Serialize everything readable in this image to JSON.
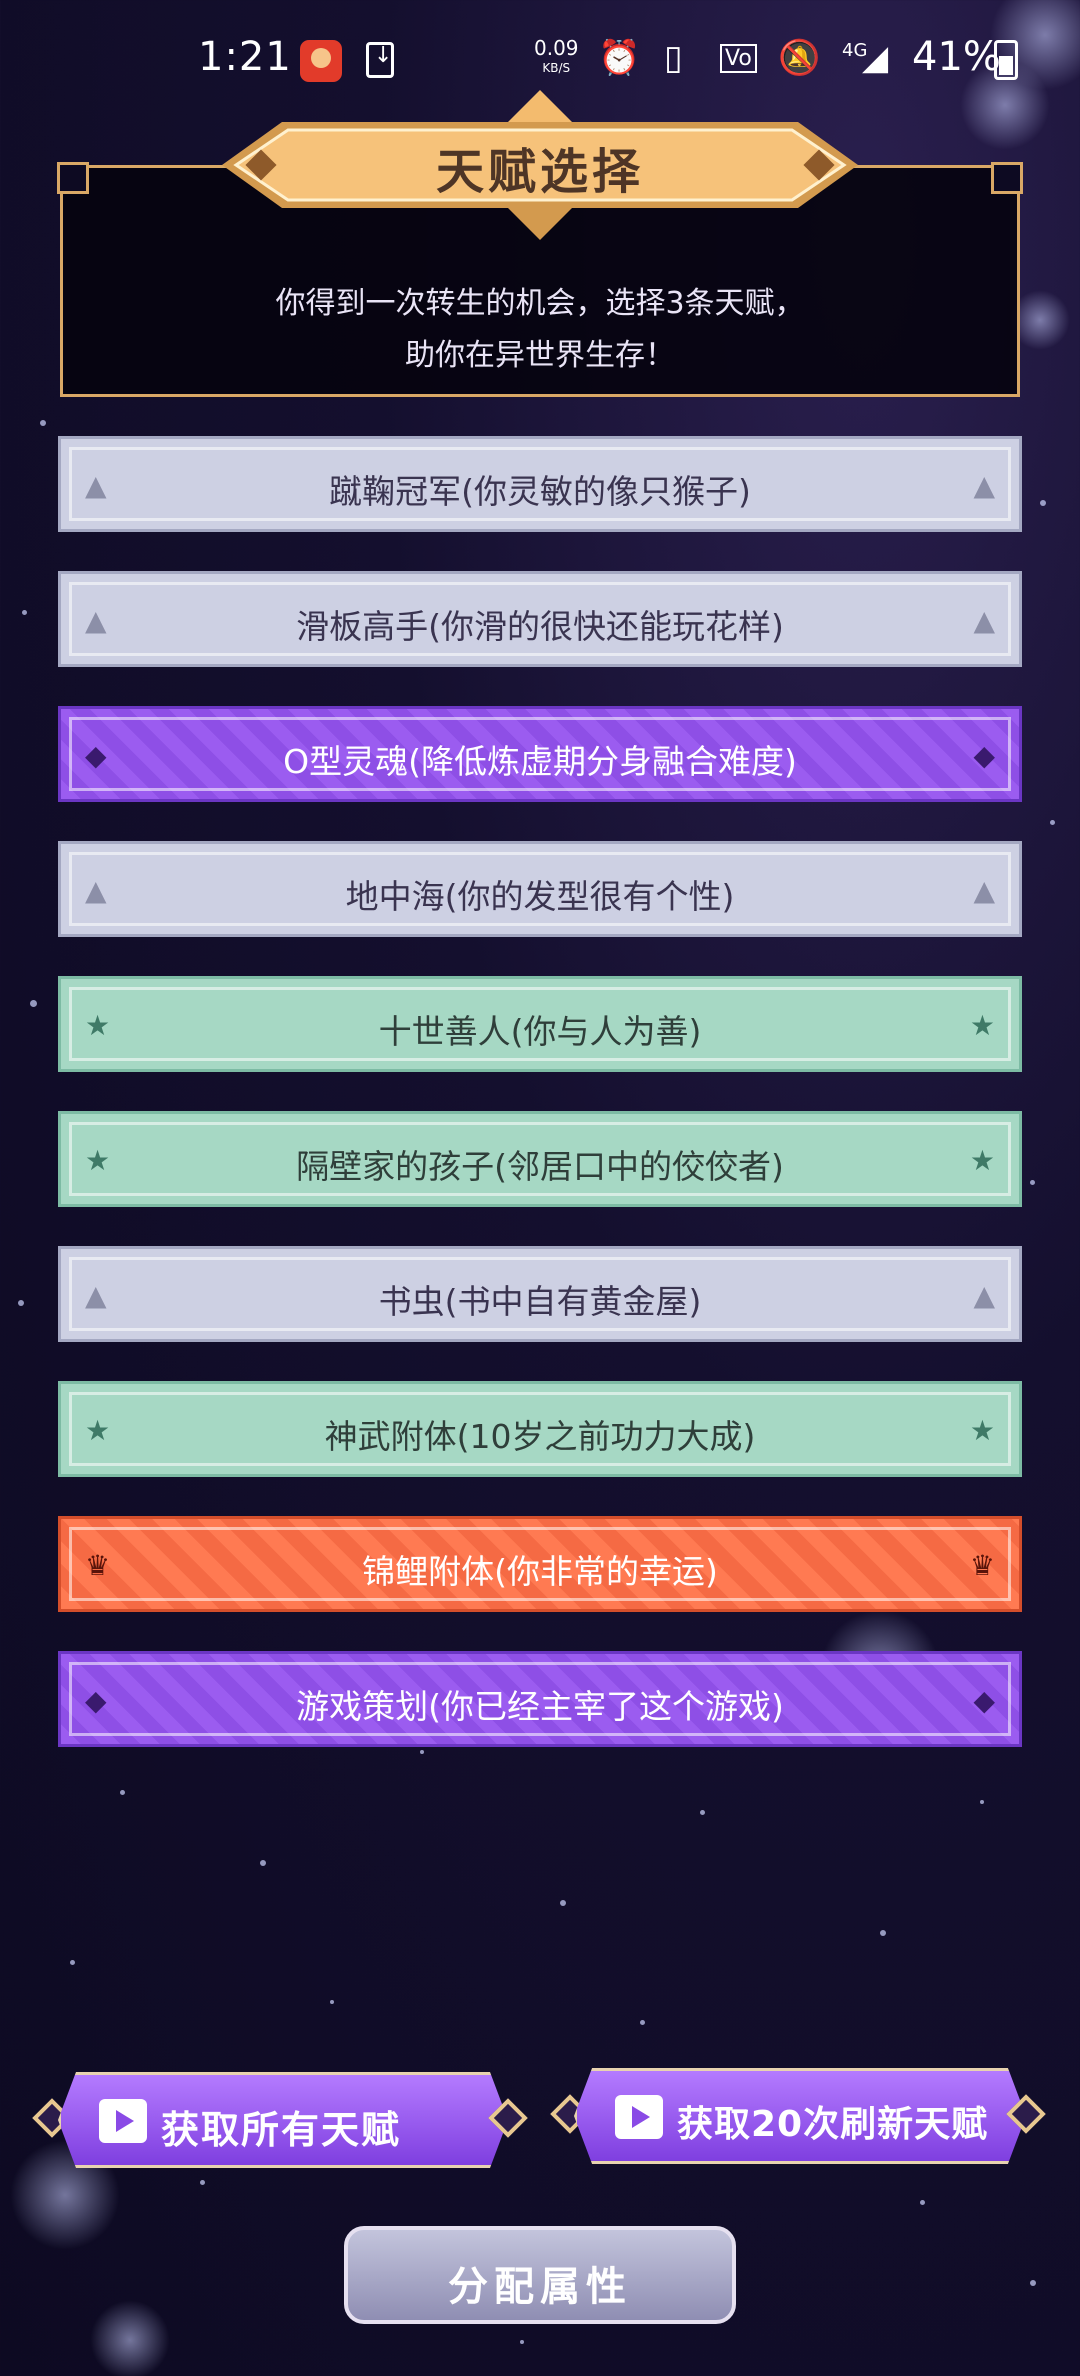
{
  "status_bar": {
    "time": "1:21",
    "speed_value": "0.09",
    "speed_unit": "KB/S",
    "network": "4G",
    "battery": "41%"
  },
  "header": {
    "title": "天赋选择",
    "subtitle_line1": "你得到一次转生的机会，选择3条天赋，",
    "subtitle_line2": "助你在异世界生存！"
  },
  "talents": [
    {
      "label": "蹴鞠冠军(你灵敏的像只猴子)",
      "rarity": "white",
      "icon": "triangle-icon"
    },
    {
      "label": "滑板高手(你滑的很快还能玩花样)",
      "rarity": "white",
      "icon": "triangle-icon"
    },
    {
      "label": "O型灵魂(降低炼虚期分身融合难度)",
      "rarity": "purple",
      "icon": "gem-icon"
    },
    {
      "label": "地中海(你的发型很有个性)",
      "rarity": "white",
      "icon": "triangle-icon"
    },
    {
      "label": "十世善人(你与人为善)",
      "rarity": "green",
      "icon": "star-icon"
    },
    {
      "label": "隔壁家的孩子(邻居口中的佼佼者)",
      "rarity": "green",
      "icon": "star-icon"
    },
    {
      "label": "书虫(书中自有黄金屋)",
      "rarity": "white",
      "icon": "triangle-icon"
    },
    {
      "label": "神武附体(10岁之前功力大成)",
      "rarity": "green",
      "icon": "star-icon"
    },
    {
      "label": "锦鲤附体(你非常的幸运)",
      "rarity": "orange",
      "icon": "crown-icon"
    },
    {
      "label": "游戏策划(你已经主宰了这个游戏)",
      "rarity": "purple",
      "icon": "gem-icon"
    }
  ],
  "buttons": {
    "get_all": "获取所有天赋",
    "refresh": "获取20次刷新天赋",
    "assign": "分配属性"
  }
}
